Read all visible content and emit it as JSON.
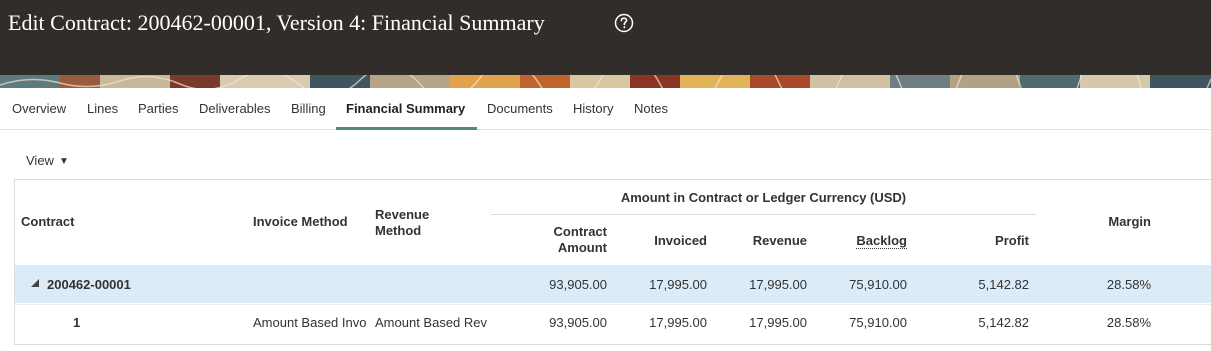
{
  "header": {
    "title": "Edit Contract: 200462-00001, Version 4: Financial Summary"
  },
  "tabs": [
    {
      "label": "Overview",
      "active": false
    },
    {
      "label": "Lines",
      "active": false
    },
    {
      "label": "Parties",
      "active": false
    },
    {
      "label": "Deliverables",
      "active": false
    },
    {
      "label": "Billing",
      "active": false
    },
    {
      "label": "Financial Summary",
      "active": true
    },
    {
      "label": "Documents",
      "active": false
    },
    {
      "label": "History",
      "active": false
    },
    {
      "label": "Notes",
      "active": false
    }
  ],
  "toolbar": {
    "view_label": "View"
  },
  "table": {
    "headers": {
      "contract": "Contract",
      "invoice_method": "Invoice Method",
      "revenue_method": "Revenue Method",
      "group": "Amount in Contract or Ledger Currency (USD)",
      "contract_amount": "Contract Amount",
      "invoiced": "Invoiced",
      "revenue": "Revenue",
      "backlog": "Backlog",
      "profit": "Profit",
      "margin": "Margin"
    },
    "rows": [
      {
        "contract": "200462-00001",
        "invoice_method": "",
        "revenue_method": "",
        "contract_amount": "93,905.00",
        "invoiced": "17,995.00",
        "revenue": "17,995.00",
        "backlog": "75,910.00",
        "profit": "5,142.82",
        "margin": "28.58%"
      },
      {
        "contract": "1",
        "invoice_method": "Amount Based Invo",
        "revenue_method": "Amount Based Rev",
        "contract_amount": "93,905.00",
        "invoiced": "17,995.00",
        "revenue": "17,995.00",
        "backlog": "75,910.00",
        "profit": "5,142.82",
        "margin": "28.58%"
      }
    ]
  },
  "colors": {
    "header_bg": "#312d2a",
    "active_tab_underline": "#4f8d6e",
    "selected_row_bg": "#dcebf8"
  }
}
